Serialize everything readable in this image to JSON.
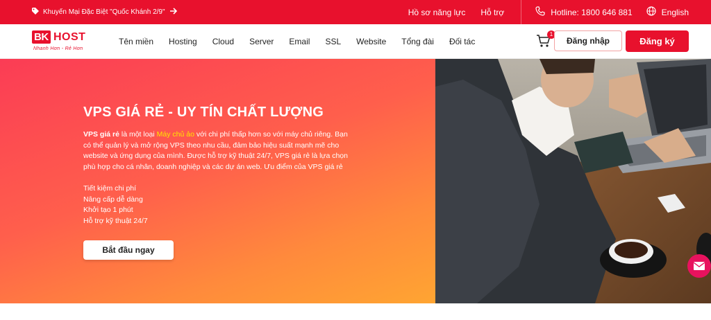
{
  "topbar": {
    "promo": "Khuyến Mại Đặc Biệt \"Quốc Khánh 2/9\"",
    "links": [
      "Hồ sơ năng lực",
      "Hỗ trợ"
    ],
    "hotline": "Hotline: 1800 646 881",
    "language": "English"
  },
  "logo": {
    "bk": "BK",
    "host": "HOST",
    "slogan": "Nhanh Hơn - Rẻ Hơn"
  },
  "nav": {
    "items": [
      "Tên miền",
      "Hosting",
      "Cloud",
      "Server",
      "Email",
      "SSL",
      "Website",
      "Tổng đài",
      "Đối tác"
    ],
    "cart_count": "1",
    "login": "Đăng nhập",
    "register": "Đăng ký"
  },
  "hero": {
    "title": "VPS GIÁ RẺ - UY TÍN CHẤT LƯỢNG",
    "desc_bold": "VPS giá rẻ",
    "desc_1": " là một loại ",
    "desc_highlight": "Máy chủ ảo",
    "desc_2": " với chi phí thấp hơn so với máy chủ riêng. Bạn có thể quản lý và mở rộng VPS theo nhu cầu, đảm bảo hiệu suất mạnh mẽ cho website và ứng dụng của mình. Được hỗ trợ kỹ thuật 24/7, VPS giá rẻ là lựa chọn phù hợp cho cá nhân, doanh nghiệp và các dự án web. Ưu điểm của VPS giá rẻ",
    "benefits": [
      "Tiết kiệm chi phí",
      "Nâng cấp dễ dàng",
      "Khởi tạo 1 phút",
      "Hỗ trợ kỹ thuật 24/7"
    ],
    "cta": "Bắt đầu ngay"
  },
  "colors": {
    "brand": "#e8112d",
    "highlight": "#ffe600",
    "fab": "#e8125e"
  }
}
